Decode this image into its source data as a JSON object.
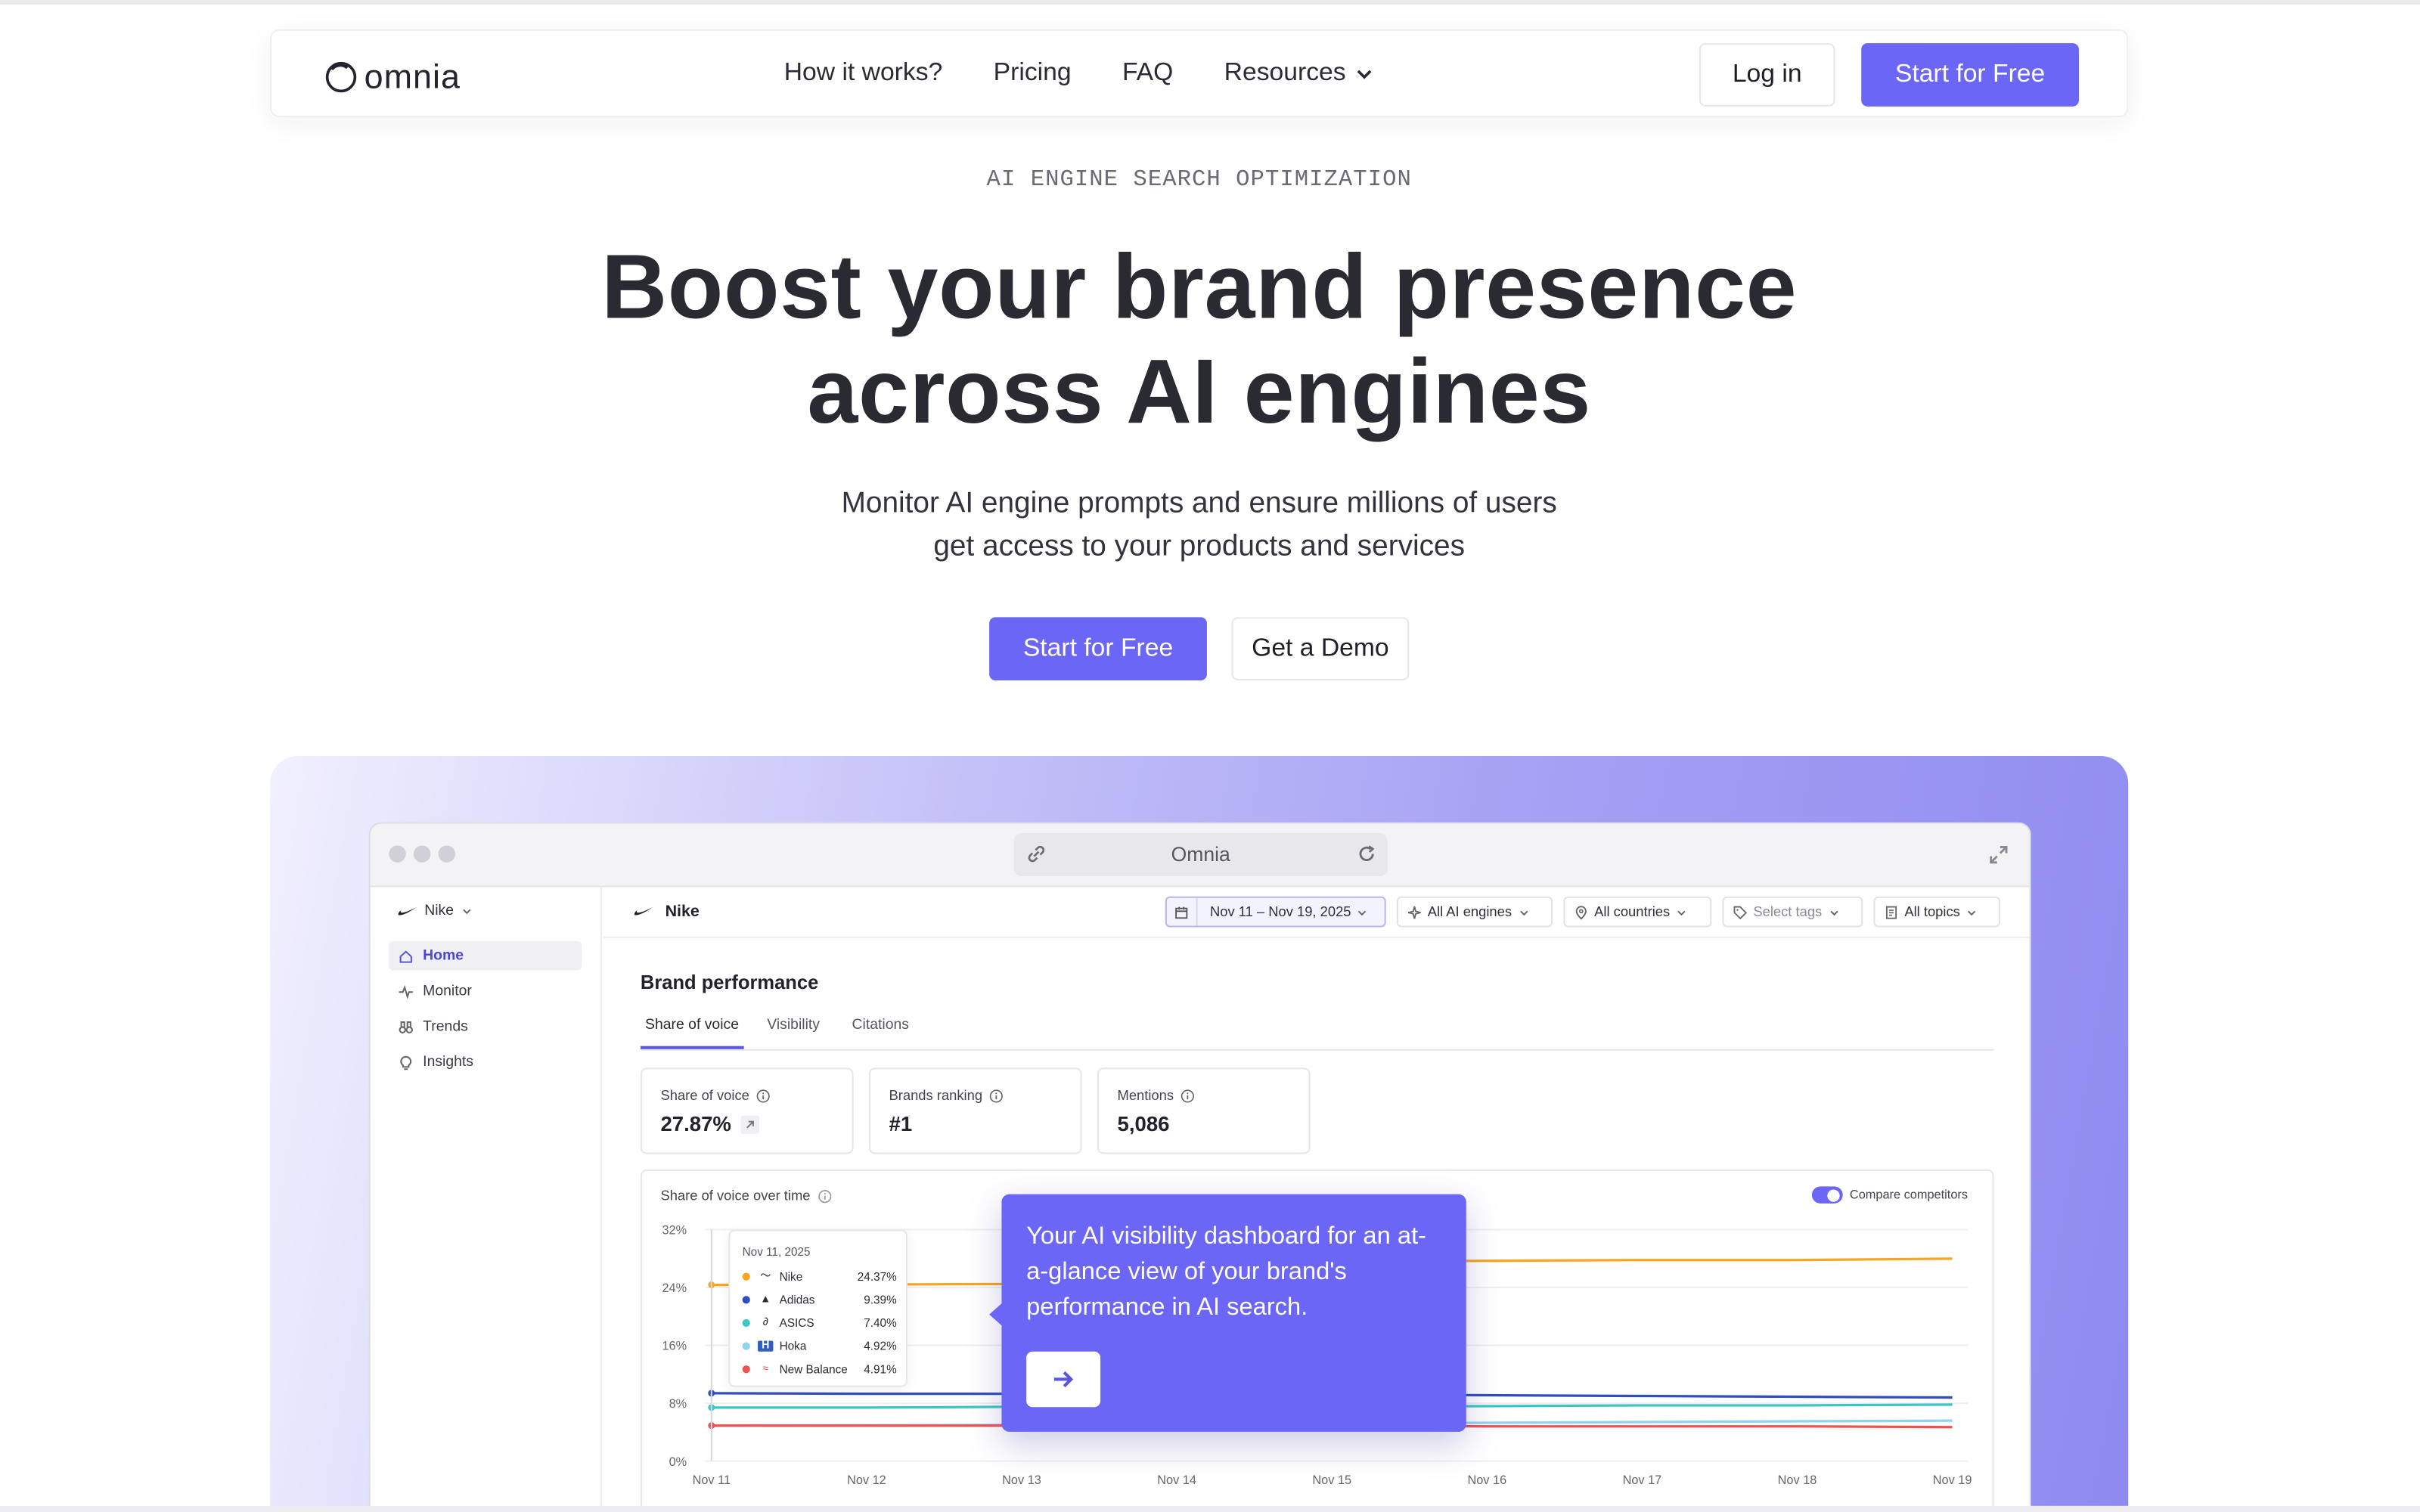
{
  "nav": {
    "logo_text": "omnia",
    "links": [
      "How it works?",
      "Pricing",
      "FAQ",
      "Resources"
    ],
    "login_label": "Log in",
    "cta_label": "Start for Free"
  },
  "hero": {
    "eyebrow": "AI ENGINE SEARCH OPTIMIZATION",
    "title_line1": "Boost your brand presence",
    "title_line2": "across AI engines",
    "subtitle_line1": "Monitor AI engine prompts and ensure millions of users",
    "subtitle_line2": "get access to your products and services",
    "primary_cta": "Start for Free",
    "secondary_cta": "Get a Demo"
  },
  "app": {
    "address_bar": "Omnia",
    "brand_selector": "Nike",
    "sidebar": [
      {
        "label": "Home",
        "icon": "home-icon",
        "active": true
      },
      {
        "label": "Monitor",
        "icon": "pulse-icon",
        "active": false
      },
      {
        "label": "Trends",
        "icon": "binoculars-icon",
        "active": false
      },
      {
        "label": "Insights",
        "icon": "lightbulb-icon",
        "active": false
      }
    ],
    "header_brand": "Nike",
    "filters": {
      "date": "Nov 11 – Nov 19, 2025",
      "engines": "All AI engines",
      "countries": "All countries",
      "tags": "Select tags",
      "topics": "All topics"
    },
    "section_title": "Brand performance",
    "tabs": [
      "Share of voice",
      "Visibility",
      "Citations"
    ],
    "active_tab": "Share of voice",
    "stats": [
      {
        "label": "Share of voice",
        "value": "27.87%"
      },
      {
        "label": "Brands ranking",
        "value": "#1"
      },
      {
        "label": "Mentions",
        "value": "5,086"
      }
    ],
    "chart_title": "Share of voice over time",
    "compare_label": "Compare competitors",
    "compare_on": true
  },
  "chart_data": {
    "type": "line",
    "title": "Share of voice over time",
    "x": [
      "Nov 11",
      "Nov 12",
      "Nov 13",
      "Nov 14",
      "Nov 15",
      "Nov 16",
      "Nov 17",
      "Nov 18",
      "Nov 19"
    ],
    "y_ticks": [
      "0%",
      "8%",
      "16%",
      "24%",
      "32%"
    ],
    "ylim": [
      0,
      32
    ],
    "grid": true,
    "series": [
      {
        "name": "Nike",
        "color": "#f5a623",
        "values": [
          24.37,
          24.4,
          24.5,
          27.5,
          27.6,
          27.7,
          27.8,
          27.8,
          28.0
        ]
      },
      {
        "name": "Adidas",
        "color": "#2f4fbf",
        "values": [
          9.39,
          9.3,
          9.3,
          9.2,
          9.2,
          9.1,
          9.0,
          8.9,
          8.8
        ]
      },
      {
        "name": "ASICS",
        "color": "#3cc6c6",
        "values": [
          7.4,
          7.4,
          7.5,
          7.5,
          7.6,
          7.6,
          7.7,
          7.7,
          7.8
        ]
      },
      {
        "name": "Hoka",
        "color": "#8fd3f0",
        "values": [
          4.92,
          4.95,
          5.0,
          5.1,
          5.2,
          5.3,
          5.4,
          5.5,
          5.6
        ]
      },
      {
        "name": "New Balance",
        "color": "#ef5350",
        "values": [
          4.91,
          4.9,
          4.9,
          4.9,
          4.9,
          4.8,
          4.8,
          4.8,
          4.7
        ]
      }
    ],
    "tooltip": {
      "date": "Nov 11, 2025",
      "rows": [
        {
          "name": "Nike",
          "value": "24.37%"
        },
        {
          "name": "Adidas",
          "value": "9.39%"
        },
        {
          "name": "ASICS",
          "value": "7.40%"
        },
        {
          "name": "Hoka",
          "value": "4.92%"
        },
        {
          "name": "New Balance",
          "value": "4.91%"
        }
      ]
    }
  },
  "callout": {
    "text": "Your AI visibility dashboard for an at-a-glance view of your brand's performance in AI search.",
    "button_icon": "arrow-right-icon"
  }
}
